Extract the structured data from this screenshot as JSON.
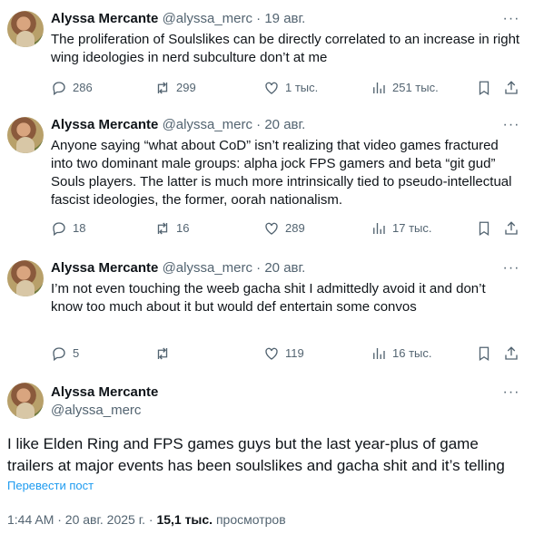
{
  "replies": [
    {
      "name": "Alyssa Mercante",
      "handle": "@alyssa_merc",
      "separator": "·",
      "date": "19 авг.",
      "text": "The proliferation of Soulslikes can be directly correlated to an increase in right wing ideologies in nerd subculture don’t at me",
      "replies_count": "286",
      "reposts_count": "299",
      "likes_count": "1 тыс.",
      "views_count": "251 тыс."
    },
    {
      "name": "Alyssa Mercante",
      "handle": "@alyssa_merc",
      "separator": "·",
      "date": "20 авг.",
      "text": "Anyone saying “what about CoD” isn’t realizing that video games fractured into two dominant male groups: alpha jock FPS gamers and beta “git gud” Souls players. The latter is much more intrinsically tied to pseudo-intellectual fascist ideologies, the former, oorah nationalism.",
      "replies_count": "18",
      "reposts_count": "16",
      "likes_count": "289",
      "views_count": "17 тыс."
    },
    {
      "name": "Alyssa Mercante",
      "handle": "@alyssa_merc",
      "separator": "·",
      "date": "20 авг.",
      "text": "I’m not even touching the weeb gacha shit I admittedly avoid it and don’t know too much about it but would def entertain some convos",
      "replies_count": "5",
      "reposts_count": "",
      "likes_count": "119",
      "views_count": "16 тыс."
    }
  ],
  "main": {
    "name": "Alyssa Mercante",
    "handle": "@alyssa_merc",
    "text": "I like Elden Ring and FPS games guys but the last year-plus of game trailers at major events has been soulslikes and gacha shit and it’s telling",
    "translate_label": "Перевести пост",
    "time": "1:44 AM · 20 авг. 2025 г. · ",
    "views_value": "15,1 тыс.",
    "views_label": " просмотров"
  },
  "icons": {
    "reply": "reply-icon",
    "repost": "repost-icon",
    "like": "heart-icon",
    "views": "views-chart-icon",
    "bookmark": "bookmark-icon",
    "share": "share-icon",
    "more": "more-icon"
  },
  "colors": {
    "text": "#0f1419",
    "secondary": "#536471",
    "link": "#1d9bf0"
  }
}
